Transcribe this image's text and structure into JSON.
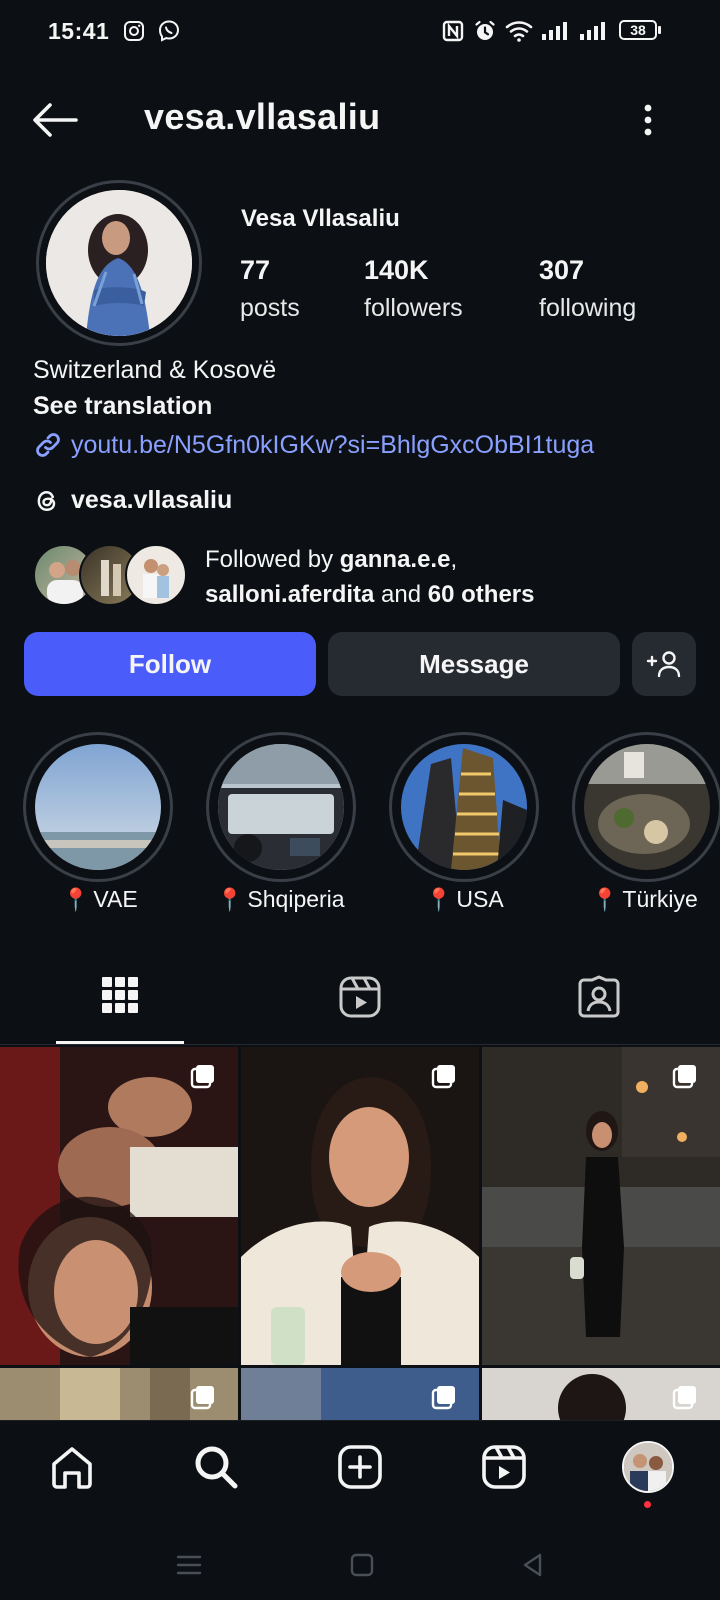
{
  "status_bar": {
    "time": "15:41",
    "battery": "38"
  },
  "header": {
    "username": "vesa.vllasaliu"
  },
  "profile": {
    "display_name": "Vesa Vllasaliu",
    "stats": [
      {
        "value": "77",
        "label": "posts"
      },
      {
        "value": "140K",
        "label": "followers"
      },
      {
        "value": "307",
        "label": "following"
      }
    ],
    "bio_line": "Switzerland & Kosovë",
    "see_translation": "See translation",
    "link": "youtu.be/N5Gfn0kIGKw?si=BhlgGxcObBI1tuga",
    "threads_handle": "vesa.vllasaliu",
    "followed_by": {
      "prefix": "Followed by ",
      "user1": "ganna.e.e",
      "comma": ",",
      "user2": "salloni.aferdita",
      "and": " and ",
      "others": "60 others"
    }
  },
  "actions": {
    "follow": "Follow",
    "message": "Message"
  },
  "highlights": [
    {
      "label": "VAE"
    },
    {
      "label": "Shqiperia"
    },
    {
      "label": "USA"
    },
    {
      "label": "Türkiye"
    }
  ],
  "icons": {
    "back": "arrow-left-icon",
    "more": "more-vertical-icon",
    "link": "link-icon",
    "threads": "threads-icon",
    "add_person": "add-person-icon",
    "grid": "grid-icon",
    "reels": "reels-icon",
    "tagged": "tagged-icon",
    "home": "home-icon",
    "search": "search-icon",
    "create": "create-icon",
    "profile": "avatar"
  },
  "colors": {
    "accent": "#4a5dfa",
    "background": "#0c1014",
    "link": "#8aa0ff",
    "badge": "#ff3040"
  }
}
